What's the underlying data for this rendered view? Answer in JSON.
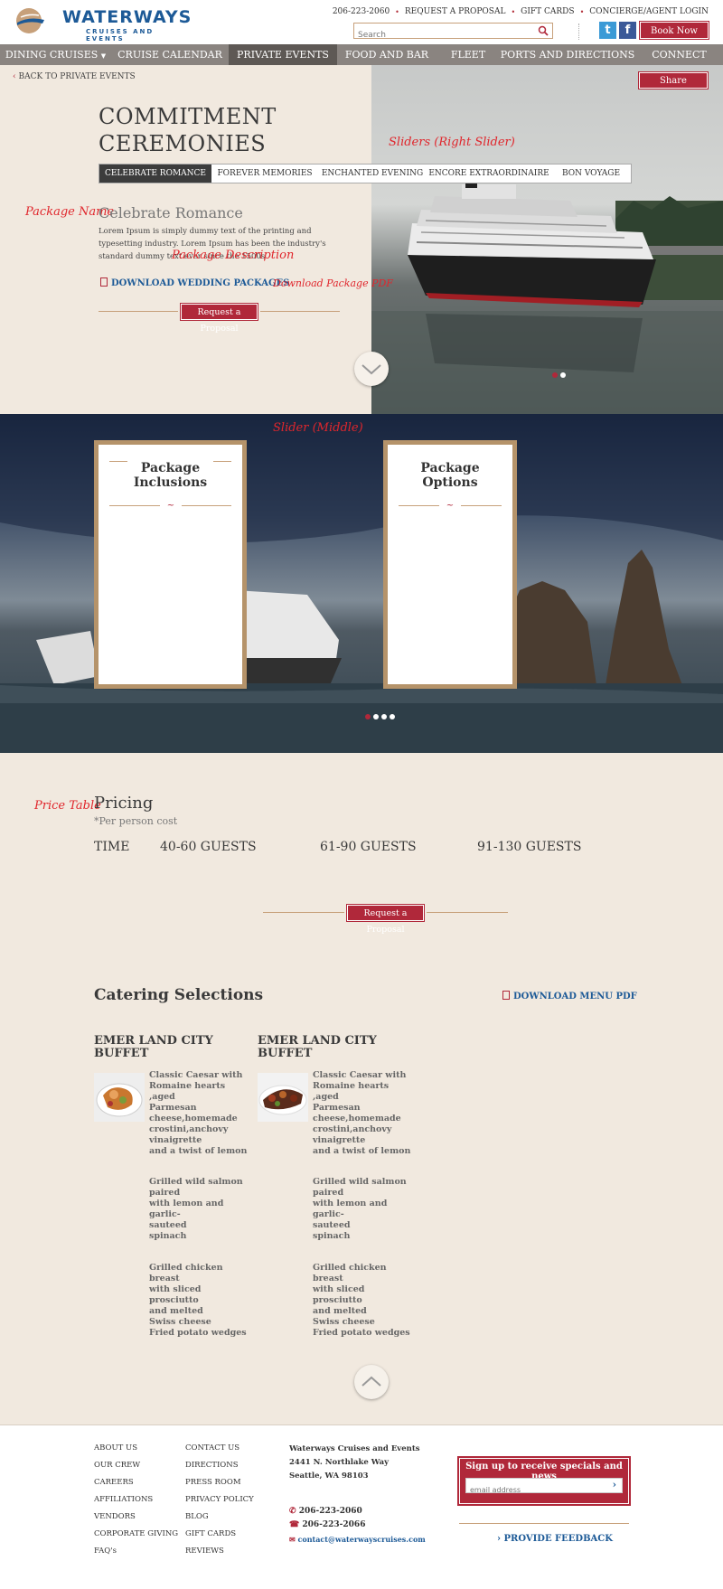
{
  "header": {
    "logo_text": "WATERWAYS",
    "logo_sub": "CRUISES AND EVENTS",
    "phone": "206-223-2060",
    "top_links": [
      "REQUEST A PROPOSAL",
      "GIFT CARDS",
      "CONCIERGE/AGENT LOGIN"
    ],
    "search_placeholder": "Search",
    "book_now": "Book Now"
  },
  "nav": {
    "items": [
      "DINING CRUISES",
      "CRUISE CALENDAR",
      "PRIVATE EVENTS",
      "FOOD AND BAR",
      "FLEET",
      "PORTS AND DIRECTIONS",
      "CONNECT"
    ],
    "active": "PRIVATE EVENTS"
  },
  "hero": {
    "back_link": "BACK TO PRIVATE EVENTS",
    "share": "Share",
    "title_line1": "COMMITMENT",
    "title_line2": "CEREMONIES",
    "tabs": [
      "CELEBRATE ROMANCE",
      "FOREVER MEMORIES",
      "ENCHANTED EVENING",
      "ENCORE EXTRAORDINAIRE",
      "BON VOYAGE"
    ],
    "package_name": "Celebrate Romance",
    "package_desc": "Lorem Ipsum is simply dummy text of the printing and typesetting industry. Lorem Ipsum has been the industry's standard dummy text ever since the 1500s",
    "download": "DOWNLOAD WEDDING PACKAGES",
    "request": "Request a Proposal"
  },
  "annotations": {
    "right_slider": "Sliders (Right Slider)",
    "package_name": "Package Name",
    "package_desc": "Package Description",
    "download_pdf": "Download Package PDF",
    "middle_slider": "Slider (Middle)",
    "price_table": "Price Table"
  },
  "middle": {
    "card1_line1": "Package",
    "card1_line2": "Inclusions",
    "card2_line1": "Package",
    "card2_line2": "Options"
  },
  "pricing": {
    "heading": "Pricing",
    "sub": "*Per person cost",
    "cols": [
      "TIME",
      "40-60 GUESTS",
      "61-90 GUESTS",
      "91-130 GUESTS"
    ],
    "request": "Request a Proposal"
  },
  "catering": {
    "heading": "Catering Selections",
    "download": "DOWNLOAD MENU PDF",
    "buffets": [
      {
        "title": "EMER LAND CITY BUFFET",
        "items": [
          "Classic Caesar with\nRomaine hearts ,aged\nParmesan\ncheese,homemade\ncrostini,anchovy\nvinaigrette\nand a twist of lemon",
          "Grilled wild salmon\npaired\nwith lemon and garlic-\nsauteed\nspinach",
          "Grilled chicken breast\nwith sliced prosciutto\nand melted\nSwiss cheese\nFried potato wedges"
        ]
      },
      {
        "title": "EMER LAND CITY BUFFET",
        "items": [
          "Classic Caesar with\nRomaine hearts ,aged\nParmesan\ncheese,homemade\ncrostini,anchovy\nvinaigrette\nand a twist of lemon",
          "Grilled wild salmon\npaired\nwith lemon and garlic-\nsauteed\nspinach",
          "Grilled chicken breast\nwith sliced prosciutto\nand melted\nSwiss cheese\nFried potato wedges"
        ]
      }
    ]
  },
  "footer": {
    "col1": [
      "ABOUT US",
      "OUR CREW",
      "CAREERS",
      "AFFILIATIONS",
      "VENDORS",
      "CORPORATE GIVING",
      "FAQ's"
    ],
    "col2": [
      "CONTACT US",
      "DIRECTIONS",
      "PRESS ROOM",
      "PRIVACY POLICY",
      "BLOG",
      "GIFT CARDS",
      "REVIEWS"
    ],
    "company": "Waterways Cruises and Events",
    "street": "2441 N. Northlake Way",
    "city": "Seattle, WA 98103",
    "phone": "206-223-2060",
    "fax": "206-223-2066",
    "email": "contact@waterwayscruises.com",
    "signup_title": "Sign up to receive specials and news",
    "signup_placeholder": "email address",
    "feedback": "PROVIDE FEEDBACK"
  },
  "colors": {
    "brand_blue": "#1d5a97",
    "accent_red": "#b0283a",
    "annotation_red": "#e0262c",
    "background": "#f1e9df"
  }
}
